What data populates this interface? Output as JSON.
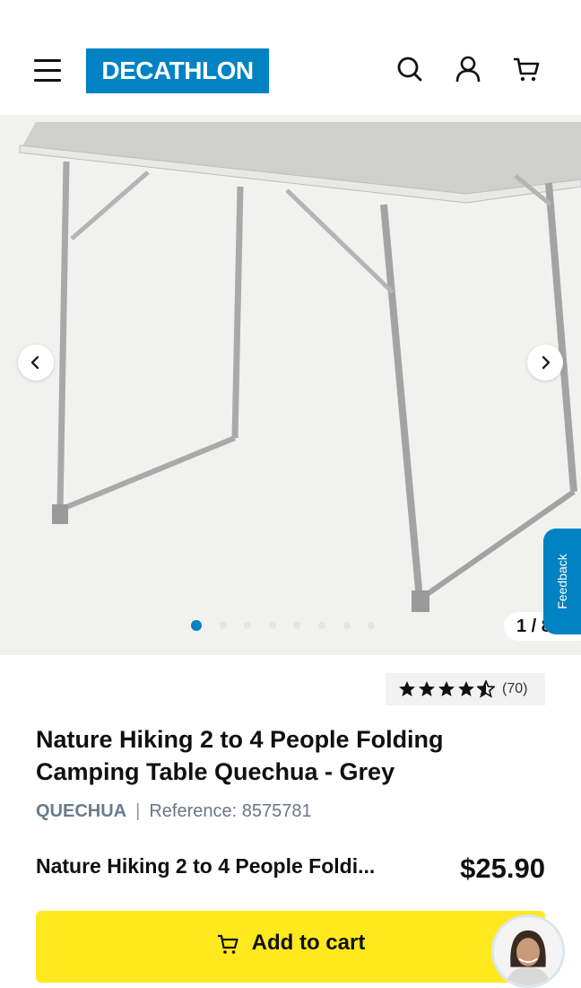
{
  "header": {
    "brand_logo_text": "DECATHLON",
    "icons": [
      "menu-icon",
      "search-icon",
      "account-icon",
      "cart-icon"
    ],
    "brand_color": "#0082c3"
  },
  "gallery": {
    "counter": "1 / 8",
    "current_image": 1,
    "total_images": 8,
    "feedback_label": "Feedback"
  },
  "product": {
    "rating_value": 4.5,
    "rating_count": "(70)",
    "title": "Nature Hiking 2 to 4 People Folding Camping Table Quechua - Grey",
    "brand": "QUECHUA",
    "reference": "Reference: 8575781",
    "sticky_name": "Nature Hiking 2 to 4 People Foldi...",
    "price": "$25.90"
  },
  "cta": {
    "add_to_cart_label": "Add to cart",
    "color": "#ffe91e"
  }
}
